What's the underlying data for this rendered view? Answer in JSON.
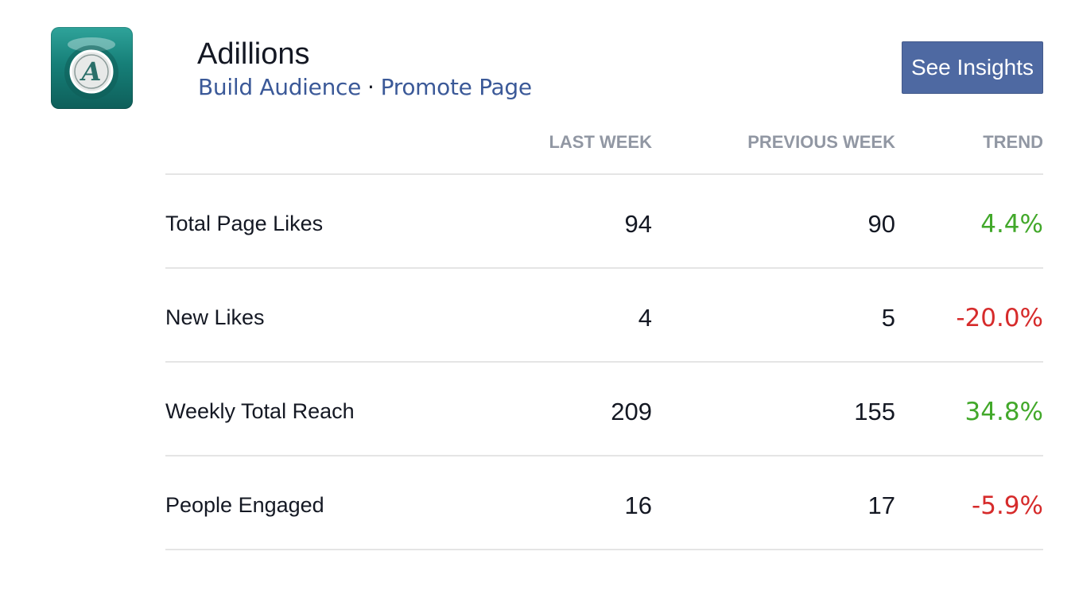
{
  "page": {
    "name": "Adillions",
    "logo_letter": "A",
    "links": [
      "Build Audience",
      "Promote Page"
    ],
    "separator": "·",
    "insights_button": "See Insights"
  },
  "table": {
    "headers": {
      "last_week": "LAST WEEK",
      "previous_week": "PREVIOUS WEEK",
      "trend": "TREND"
    },
    "rows": [
      {
        "metric": "Total Page Likes",
        "last_week": "94",
        "previous_week": "90",
        "trend": "4.4%",
        "direction": "up"
      },
      {
        "metric": "New Likes",
        "last_week": "4",
        "previous_week": "5",
        "trend": "-20.0%",
        "direction": "down"
      },
      {
        "metric": "Weekly Total Reach",
        "last_week": "209",
        "previous_week": "155",
        "trend": "34.8%",
        "direction": "up"
      },
      {
        "metric": "People Engaged",
        "last_week": "16",
        "previous_week": "17",
        "trend": "-5.9%",
        "direction": "down"
      }
    ]
  },
  "colors": {
    "link": "#3b5998",
    "button": "#4e69a2",
    "trend_up": "#42a82a",
    "trend_down": "#d62b2b",
    "header_text": "#9197a3"
  }
}
